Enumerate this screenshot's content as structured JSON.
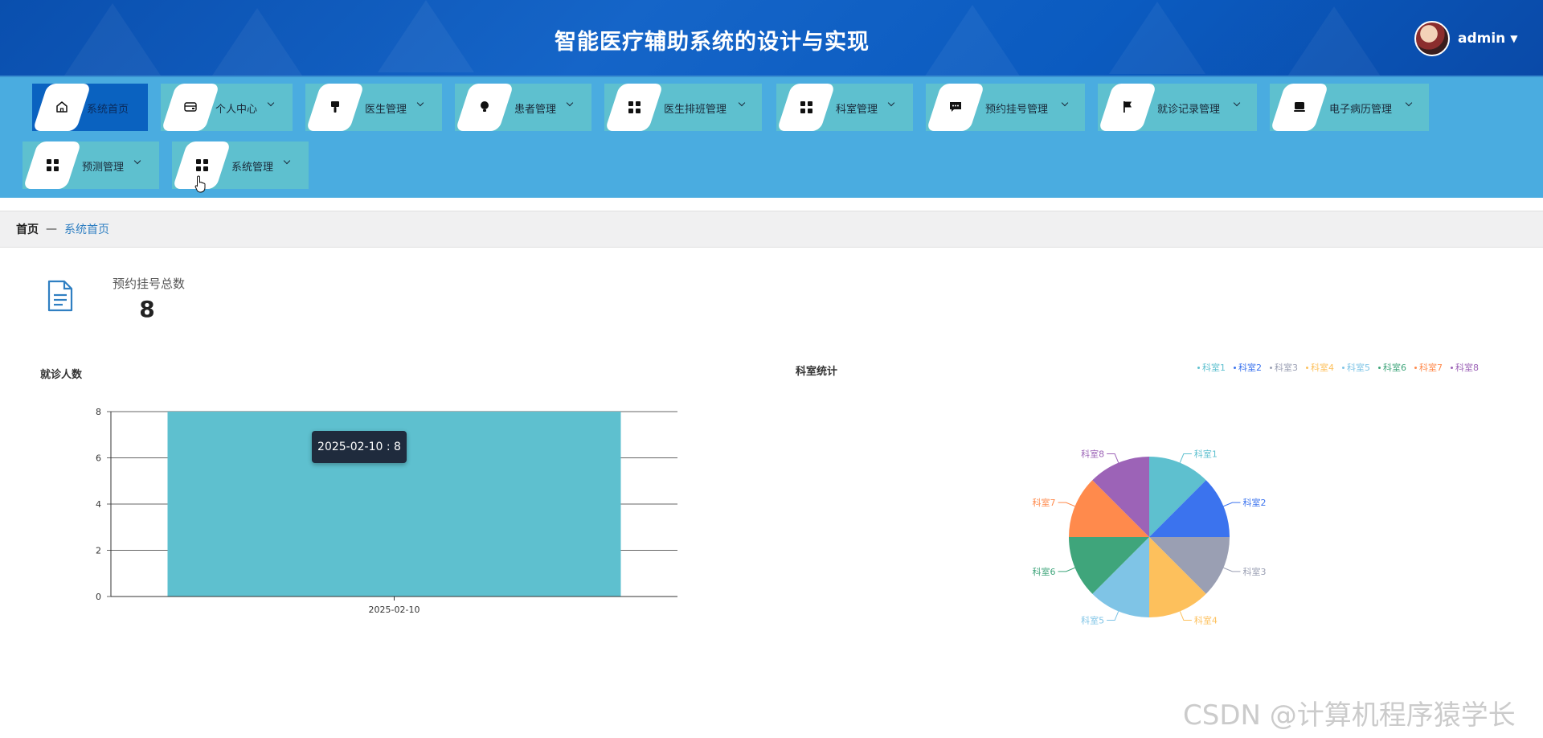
{
  "header": {
    "title": "智能医疗辅助系统的设计与实现",
    "username": "admin"
  },
  "nav": {
    "items": [
      {
        "label": "系统首页",
        "icon": "home-icon",
        "active": true,
        "caret": false
      },
      {
        "label": "个人中心",
        "icon": "wallet-icon",
        "active": false,
        "caret": true
      },
      {
        "label": "医生管理",
        "icon": "brush-icon",
        "active": false,
        "caret": true
      },
      {
        "label": "患者管理",
        "icon": "bulb-icon",
        "active": false,
        "caret": true
      },
      {
        "label": "医生排班管理",
        "icon": "grid-icon",
        "active": false,
        "caret": true
      },
      {
        "label": "科室管理",
        "icon": "grid-icon",
        "active": false,
        "caret": true
      },
      {
        "label": "预约挂号管理",
        "icon": "message-icon",
        "active": false,
        "caret": true
      },
      {
        "label": "就诊记录管理",
        "icon": "flag-icon",
        "active": false,
        "caret": true
      },
      {
        "label": "电子病历管理",
        "icon": "monitor-icon",
        "active": false,
        "caret": true
      },
      {
        "label": "预测管理",
        "icon": "grid-icon",
        "active": false,
        "caret": true
      },
      {
        "label": "系统管理",
        "icon": "grid-icon",
        "active": false,
        "caret": true
      }
    ]
  },
  "breadcrumb": {
    "home": "首页",
    "separator": "—",
    "current": "系统首页"
  },
  "stat": {
    "label": "预约挂号总数",
    "value": "8",
    "icon": "document-icon"
  },
  "charts": {
    "bar_title": "就诊人数",
    "pie_title": "科室统计",
    "tooltip": "2025-02-10 : 8"
  },
  "chart_data": [
    {
      "type": "bar",
      "title": "就诊人数",
      "categories": [
        "2025-02-10"
      ],
      "values": [
        8
      ],
      "ylim": [
        0,
        8
      ],
      "yticks": [
        "0",
        "2",
        "4",
        "6",
        "8"
      ],
      "grid": true,
      "color": "#5ec0cf"
    },
    {
      "type": "pie",
      "title": "科室统计",
      "legend_position": "top-right",
      "labels": [
        "科室1",
        "科室2",
        "科室3",
        "科室4",
        "科室5",
        "科室6",
        "科室7",
        "科室8"
      ],
      "values": [
        1,
        1,
        1,
        1,
        1,
        1,
        1,
        1
      ],
      "colors": [
        "#5ec0cf",
        "#3b73ee",
        "#9a9fb3",
        "#fdc05c",
        "#7fc4e6",
        "#3fa57b",
        "#ff8a4c",
        "#9c63b7"
      ]
    }
  ],
  "watermark": "CSDN @计算机程序猿学长"
}
